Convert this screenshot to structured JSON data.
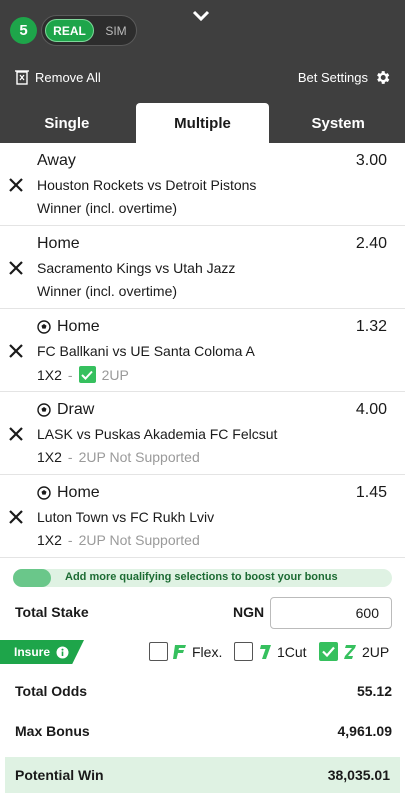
{
  "header": {
    "selection_count": "5",
    "mode_real": "REAL",
    "mode_sim": "SIM",
    "remove_all": "Remove All",
    "bet_settings": "Bet Settings"
  },
  "tabs": [
    "Single",
    "Multiple",
    "System"
  ],
  "selections": [
    {
      "pick": "Away",
      "odds": "3.00",
      "match": "Houston Rockets vs Detroit Pistons",
      "market": "Winner (incl. overtime)",
      "sport_icon": "",
      "twoup": ""
    },
    {
      "pick": "Home",
      "odds": "2.40",
      "match": "Sacramento Kings vs Utah Jazz",
      "market": "Winner (incl. overtime)",
      "sport_icon": "",
      "twoup": ""
    },
    {
      "pick": "Home",
      "odds": "1.32",
      "match": "FC Ballkani vs UE Santa Coloma A",
      "market": "1X2",
      "sport_icon": "soccer-ball-icon",
      "twoup": "2UP",
      "twoup_checked": true
    },
    {
      "pick": "Draw",
      "odds": "4.00",
      "match": "LASK vs Puskas Akademia FC Felcsut",
      "market": "1X2",
      "sport_icon": "soccer-ball-icon",
      "twoup": "2UP Not Supported",
      "twoup_checked": false
    },
    {
      "pick": "Home",
      "odds": "1.45",
      "match": "Luton Town vs FC Rukh Lviv",
      "market": "1X2",
      "sport_icon": "soccer-ball-icon",
      "twoup": "2UP Not Supported",
      "twoup_checked": false
    }
  ],
  "bonus_bar": {
    "text": "Add more qualifying selections to boost your bonus",
    "progress": 0.1
  },
  "stake": {
    "label": "Total Stake",
    "currency": "NGN",
    "value": "600"
  },
  "insure": {
    "label": "Insure",
    "flex": "Flex.",
    "one_cut": "1Cut",
    "two_up": "2UP",
    "flex_checked": false,
    "one_cut_checked": false,
    "two_up_checked": true
  },
  "totals": {
    "total_odds_label": "Total Odds",
    "total_odds": "55.12",
    "max_bonus_label": "Max Bonus",
    "max_bonus": "4,961.09",
    "potential_win_label": "Potential Win",
    "potential_win": "38,035.01"
  },
  "colors": {
    "accent": "#1ea54a",
    "header_bg": "#3f3f3f",
    "check": "#36c05e"
  }
}
